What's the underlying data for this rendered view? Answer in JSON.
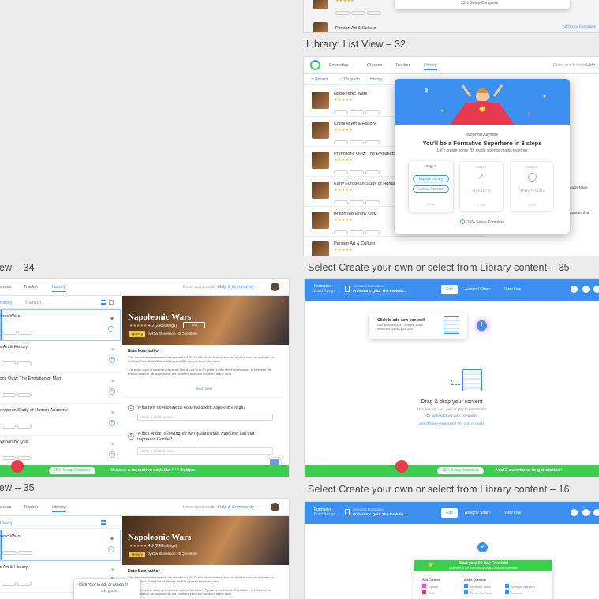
{
  "labels": {
    "top_right": "Library: List View – 32",
    "mid_left": "iew – 34",
    "mid_right": "Select Create your own or select from Library content – 35",
    "bottom_left": "iew – 35",
    "bottom_right": "Select Create your own or select from Library content – 16"
  },
  "nav": {
    "logo": "Formative",
    "classes": "Classes",
    "tracker": "Tracker",
    "library": "Library",
    "help": "Help & Community",
    "enter_code": "Enter quick code",
    "search": "Search",
    "history": "History"
  },
  "top_frame": {
    "last_item": "Persian Art & Culture",
    "setup_text": "25% Setup Complete",
    "add_link": "Add to my formatives"
  },
  "library_list": {
    "items": [
      {
        "title": "Napoleonic Wars",
        "heart": true
      },
      {
        "title": "Chinese Art & History",
        "heart": false
      },
      {
        "title": "Prehistoric Quiz: The Evolution of Man",
        "heart": false
      },
      {
        "title": "Early European Study of Human Anatomy",
        "heart": false
      },
      {
        "title": "British Monarchy Quiz",
        "heart": false
      },
      {
        "title": "Persian Art & Culture",
        "heart": false
      }
    ],
    "side_snippets": [
      "under Napo",
      "qualities that"
    ]
  },
  "superhero_modal": {
    "greeting": "Woohoo Allyson!",
    "headline": "You'll be a Formative Superhero in 3 steps",
    "subline": "Let's create some 7th grade science magic together",
    "steps": [
      {
        "label": "Step 1",
        "title": "",
        "buttons": [
          "Explore Library",
          "Upload / Create"
        ],
        "note": "2 min"
      },
      {
        "label": "Step 2",
        "title": "Assign it",
        "note": "1 min"
      },
      {
        "label": "Step 3",
        "title": "View results",
        "note": "1 min"
      }
    ],
    "progress": "25% Setup Complete"
  },
  "detail_frame": {
    "history_tab": "History",
    "search": "Search",
    "list_items": [
      {
        "title": "Napoleonic Wars",
        "heart": true
      },
      {
        "title": "Chinese Art & History",
        "heart": false
      },
      {
        "title": "Prehistoric Quiz: The Evolution of Man",
        "heart": false
      },
      {
        "title": "Early European Study of Human Anatomy",
        "heart": false
      },
      {
        "title": "British Monarchy Quiz",
        "heart": false
      }
    ],
    "hero_title": "Napoleonic Wars",
    "hero_rating": "4.9 (248 ratings)",
    "hero_author": "by Gia Stevenson",
    "hero_questions": "6 Questions",
    "hero_tag": "History",
    "note_heading": "Note from author",
    "note_text": "This formative assessment was created for 9th Grade World History. It could also be used as a starter for the New York State Global History and Geography Regents exam.",
    "note_text2": "The basic topic is whether Napoleon was a Son of or a Tyrant to the French Revolution. In between the French and the 1st Napoleonic are covered, students will learn many facts.",
    "read_more": "read more",
    "q1": "What new developments occurred under Napoleon's reign?",
    "q2": "Which of the following are two qualities that Napoleon had that impressed Goethe?",
    "answer_placeholder": "Write a short answer...",
    "bottom_setup": "25% Setup Complete",
    "bottom_cta": "Choose a formative with the \"+\" button."
  },
  "editor_frame": {
    "brand": "Formative",
    "brand_sub": "Build Assign",
    "formative_small": "Selected Formative",
    "formative_title": "Prehistoric Quiz: The Evolutio...",
    "tabs": [
      "Edit",
      "Assign / Share",
      "View Live"
    ],
    "callout_title": "Click to add new content!",
    "callout_text": "Add question types, images, video, embed or upload your own.",
    "drop_title": "Drag & drop your content",
    "drop_sub": "Use any pdf, doc, jpeg or png to get started!",
    "upload_link": "Or, upload from your computer",
    "no_file_link": "Don't have your own? Try one of ours!",
    "bottom_setup": "25% Setup Complete",
    "bottom_cta": "Add 2 questions to get started!"
  },
  "bottom_detail": {
    "tooltip_title": "Click \"Go\" to edit or assign it!",
    "tooltip_link": "Ok, got it!"
  },
  "bottom_editor": {
    "trial_title": "Start your 90 day Free trial",
    "trial_sub": "Click here to get unlimited uploads & advanced premium",
    "col1_title": "Add Content",
    "col2_title": "Add a Question",
    "items": [
      "Upload",
      "Text",
      "Multiple Choice",
      "Show Your Work",
      "Multiple Selection",
      "Numeric"
    ]
  },
  "colors": {
    "blue": "#3d8ff0",
    "green": "#3ccf4e",
    "red": "#e53b4c",
    "star": "#f5a623"
  }
}
